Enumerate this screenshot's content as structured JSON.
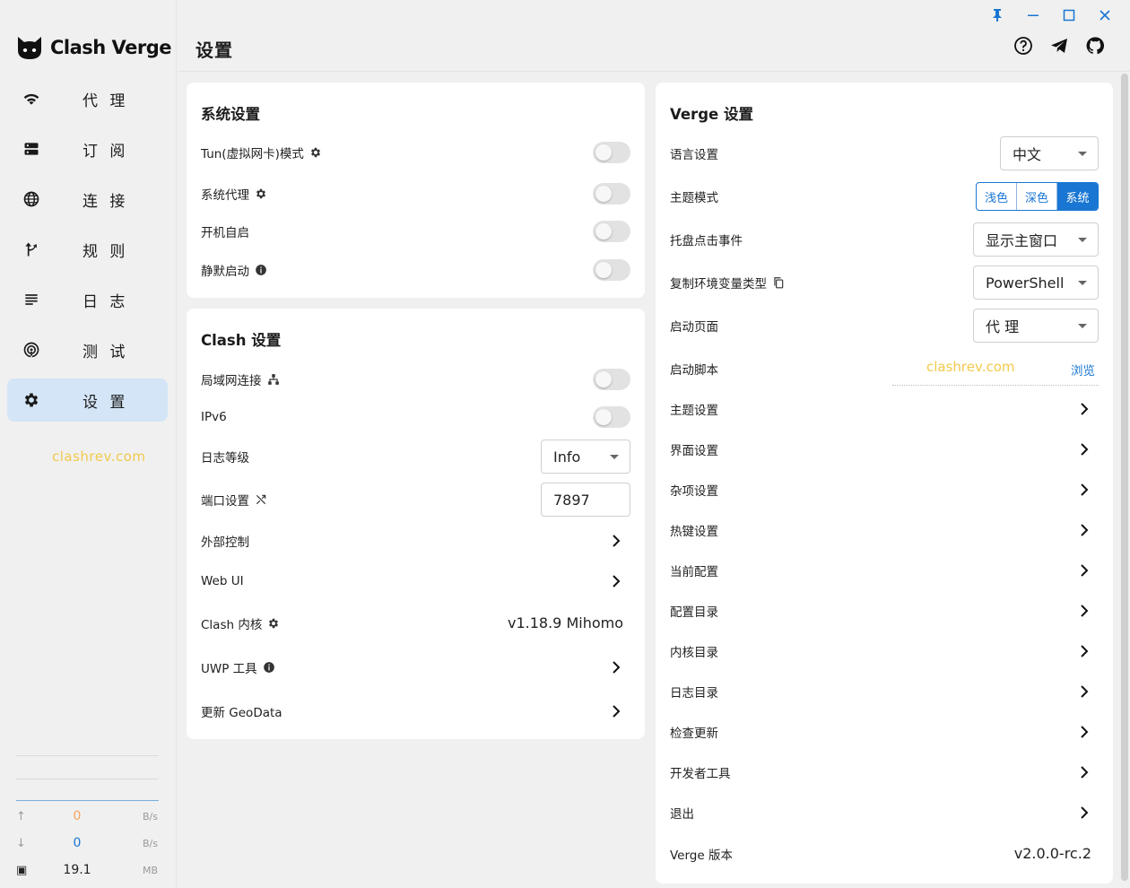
{
  "window": {
    "controls": [
      "pin-icon",
      "minimize-icon",
      "maximize-icon",
      "close-icon"
    ],
    "accent": "#1976d2"
  },
  "app": {
    "name": "Clash Verge"
  },
  "sidebar": {
    "items": [
      {
        "label": "代 理",
        "icon": "wifi-icon"
      },
      {
        "label": "订 阅",
        "icon": "server-icon"
      },
      {
        "label": "连 接",
        "icon": "globe-icon"
      },
      {
        "label": "规 则",
        "icon": "route-icon"
      },
      {
        "label": "日 志",
        "icon": "list-icon"
      },
      {
        "label": "测 试",
        "icon": "radar-icon"
      },
      {
        "label": "设 置",
        "icon": "gear-icon"
      }
    ],
    "active": "设 置",
    "watermark": "clashrev.com",
    "traffic": {
      "up": {
        "value": "0",
        "unit": "B/s",
        "color": "#f4a460"
      },
      "down": {
        "value": "0",
        "unit": "B/s",
        "color": "#1976d2"
      },
      "mem": {
        "value": "19.1",
        "unit": "MB"
      }
    }
  },
  "header": {
    "title": "设置",
    "icons": [
      "help-icon",
      "telegram-icon",
      "github-icon"
    ]
  },
  "system_settings": {
    "title": "系统设置",
    "rows": [
      {
        "label": "Tun(虚拟网卡)模式",
        "toggle": false
      },
      {
        "label": "系统代理",
        "toggle": false
      },
      {
        "label": "开机自启",
        "toggle": false
      },
      {
        "label": "静默启动",
        "toggle": false
      }
    ]
  },
  "clash_settings": {
    "title": "Clash 设置",
    "lan": {
      "label": "局域网连接",
      "toggle": false
    },
    "ipv6": {
      "label": "IPv6",
      "toggle": false
    },
    "log_level": {
      "label": "日志等级",
      "value": "Info"
    },
    "port": {
      "label": "端口设置",
      "value": "7897"
    },
    "external": {
      "label": "外部控制"
    },
    "webui": {
      "label": "Web UI"
    },
    "core": {
      "label": "Clash 内核",
      "value": "v1.18.9 Mihomo"
    },
    "uwp": {
      "label": "UWP 工具"
    },
    "geodata": {
      "label": "更新 GeoData"
    }
  },
  "verge_settings": {
    "title": "Verge 设置",
    "language": {
      "label": "语言设置",
      "value": "中文"
    },
    "theme_mode": {
      "label": "主题模式",
      "options": [
        "浅色",
        "深色",
        "系统"
      ],
      "selected": "系统"
    },
    "tray_click": {
      "label": "托盘点击事件",
      "value": "显示主窗口"
    },
    "copy_env": {
      "label": "复制环境变量类型",
      "value": "PowerShell"
    },
    "start_page": {
      "label": "启动页面",
      "value": "代 理"
    },
    "start_script": {
      "label": "启动脚本",
      "watermark": "clashrev.com",
      "browse": "浏览"
    },
    "links": [
      "主题设置",
      "界面设置",
      "杂项设置",
      "热键设置",
      "当前配置",
      "配置目录",
      "内核目录",
      "日志目录",
      "检查更新",
      "开发者工具",
      "退出"
    ],
    "version": {
      "label": "Verge 版本",
      "value": "v2.0.0-rc.2"
    }
  }
}
